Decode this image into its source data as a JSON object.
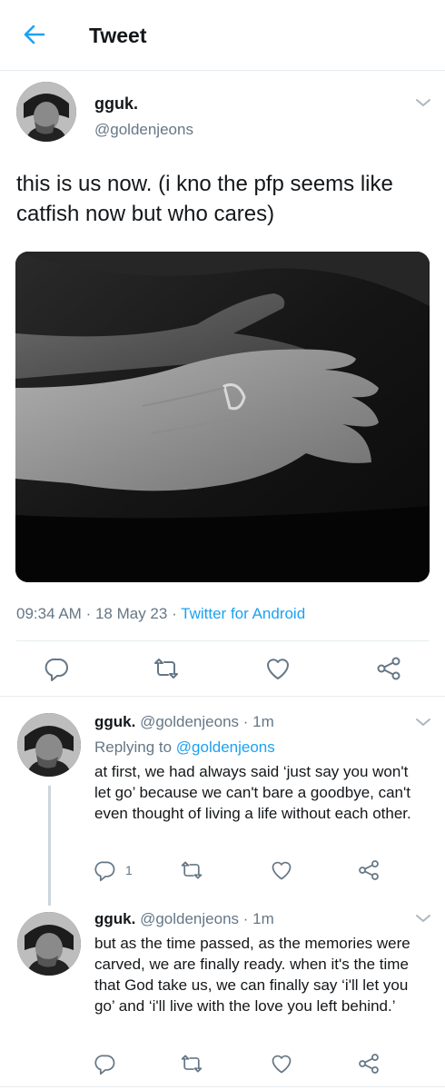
{
  "header": {
    "title": "Tweet",
    "back_icon": "arrow-left-icon"
  },
  "colors": {
    "accent": "#1da1f2",
    "secondary_text": "#657786",
    "divider": "#e6ecf0"
  },
  "tweet": {
    "author_name": "gguk.",
    "author_handle": "@goldenjeons",
    "text": "this is us now. (i kno the pfp seems like catfish now but who cares)",
    "time": "09:34 AM",
    "date": "18 May 23",
    "source": "Twitter for Android",
    "actions": [
      "reply-icon",
      "retweet-icon",
      "like-icon",
      "share-icon"
    ]
  },
  "replies": [
    {
      "author_name": "gguk.",
      "author_handle": "@goldenjeons",
      "time_ago": "1m",
      "replying_prefix": "Replying to",
      "replying_to": "@goldenjeons",
      "text": "at first, we had always said ‘just say you won't let go’ because we can't bare a goodbye, can't even thought of living a life without each other.",
      "reply_count": "1"
    },
    {
      "author_name": "gguk.",
      "author_handle": "@goldenjeons",
      "time_ago": "1m",
      "text": "but as the time passed, as the memories were carved, we are finally ready. when it's the time that God take us, we can finally say ‘i'll let you go’ and ‘i'll live with the love you left behind.’",
      "reply_count": ""
    }
  ]
}
